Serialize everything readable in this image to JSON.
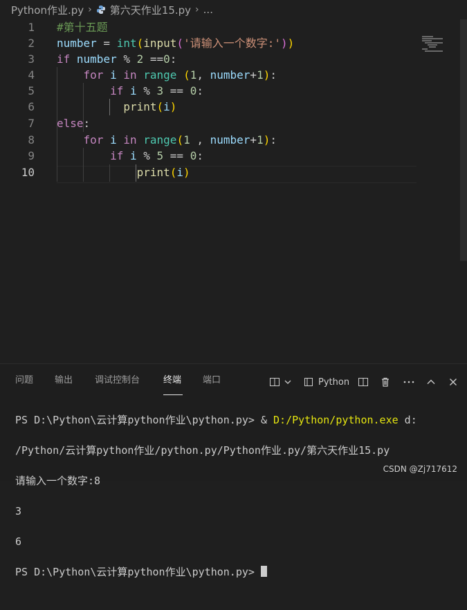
{
  "breadcrumb": {
    "folder": "Python作业.py",
    "file": "第六天作业15.py",
    "more": "..."
  },
  "editor": {
    "lines": [
      {
        "n": "1"
      },
      {
        "n": "2"
      },
      {
        "n": "3"
      },
      {
        "n": "4"
      },
      {
        "n": "5"
      },
      {
        "n": "6"
      },
      {
        "n": "7"
      },
      {
        "n": "8"
      },
      {
        "n": "9"
      },
      {
        "n": "10"
      }
    ],
    "active_line": "10",
    "code": {
      "l1": "#第十五题",
      "l2_var": "number",
      "l2_eq": " = ",
      "l2_int": "int",
      "l2_input": "input",
      "l2_str": "'请输入一个数字:'",
      "l3_if": "if",
      "l3_rest_var": "number",
      "l3_op": " % ",
      "l3_num2": "2",
      "l3_cmp": " ==",
      "l3_num0": "0",
      "l3_colon": ":",
      "l4_for": "for",
      "l4_i": "i",
      "l4_in": "in",
      "l4_range": "range",
      "l4_args_start": "1",
      "l4_args_var": "number",
      "l4_args_plus": "+",
      "l4_args_1": "1",
      "l5_if": "if",
      "l5_i": "i",
      "l5_num": "3",
      "l5_zero": "0",
      "l6_print": "print",
      "l6_i": "i",
      "l7_else": "else",
      "l8_for": "for",
      "l8_i": "i",
      "l8_in": "in",
      "l8_range": "range",
      "l8_start": "1",
      "l8_var": "number",
      "l8_one": "1",
      "l9_if": "if",
      "l9_i": "i",
      "l9_num": "5",
      "l9_zero": "0",
      "l10_print": "print",
      "l10_i": "i"
    }
  },
  "panel": {
    "tabs": [
      "问题",
      "输出",
      "调试控制台",
      "终端",
      "端口"
    ],
    "active_tab": "终端",
    "shell_label": "Python",
    "terminal": {
      "line1_prefix": "PS D:\\Python\\云计算python作业\\python.py> & ",
      "line1_exe": "D:/Python/python.exe",
      "line1_suffix": " d:",
      "line2": "/Python/云计算python作业/python.py/Python作业.py/第六天作业15.py",
      "line3": "请输入一个数字:8",
      "line4": "3",
      "line5": "6",
      "line6": "PS D:\\Python\\云计算python作业\\python.py> "
    }
  },
  "watermark": "CSDN @Zj717612",
  "colors": {
    "background": "#1f1f1f",
    "keyword_control": "#c586c0",
    "keyword": "#569cd6",
    "variable": "#9cdcfe",
    "function": "#dcdcaa",
    "class": "#4ec9b0",
    "string": "#ce9178",
    "number": "#b5cea8",
    "comment": "#6a9955",
    "terminal_path": "#e5e510"
  }
}
